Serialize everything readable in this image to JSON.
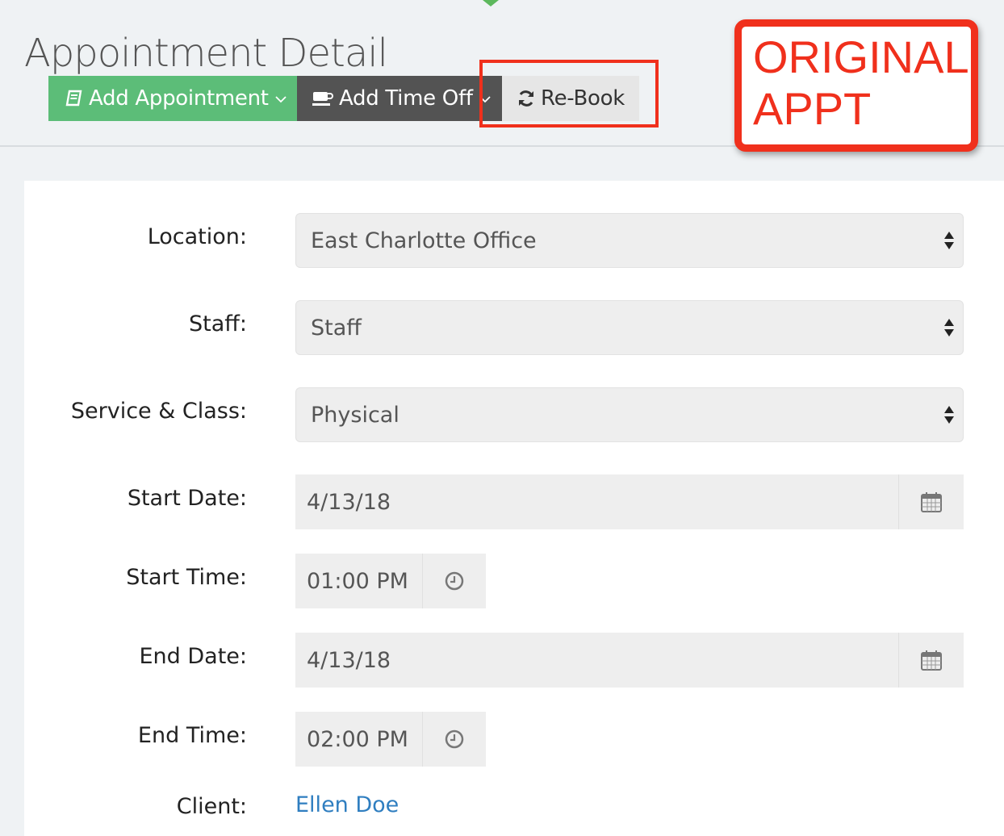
{
  "header": {
    "title": "Appointment Detail"
  },
  "toolbar": {
    "add_appointment_label": "Add Appointment",
    "add_time_off_label": "Add Time Off",
    "rebook_label": "Re-Book"
  },
  "annotation": {
    "callout_line1": "ORIGINAL",
    "callout_line2": "APPT",
    "color": "#f0301c"
  },
  "form": {
    "location": {
      "label": "Location:",
      "value": "East Charlotte Office"
    },
    "staff": {
      "label": "Staff:",
      "value": "Staff"
    },
    "service": {
      "label": "Service & Class:",
      "value": "Physical"
    },
    "start_date": {
      "label": "Start Date:",
      "value": "4/13/18"
    },
    "start_time": {
      "label": "Start Time:",
      "value": "01:00 PM"
    },
    "end_date": {
      "label": "End Date:",
      "value": "4/13/18"
    },
    "end_time": {
      "label": "End Time:",
      "value": "02:00 PM"
    },
    "client": {
      "label": "Client:",
      "value": "Ellen Doe"
    }
  },
  "colors": {
    "primary_green": "#5cbd78",
    "dark_button": "#535353",
    "link_blue": "#2f7ec0"
  },
  "icons": {
    "add_appointment": "book-icon",
    "add_time_off": "coffee-cup-icon",
    "rebook": "refresh-icon",
    "date": "calendar-icon",
    "time": "clock-icon"
  }
}
